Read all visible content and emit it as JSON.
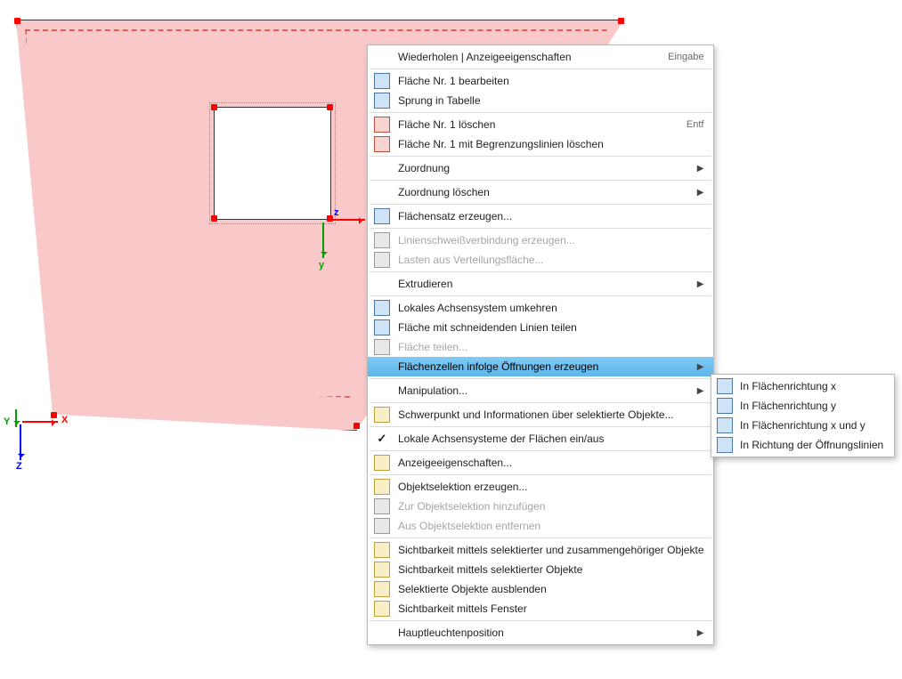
{
  "axes": {
    "x": "x",
    "y": "y",
    "z": "z"
  },
  "axes_global": {
    "x": "X",
    "y": "Y",
    "z": "Z"
  },
  "menu": {
    "repeat_display_props": "Wiederholen | Anzeigeeigenschaften",
    "repeat_shortcut": "Eingabe",
    "edit_surface_1": "Fläche Nr. 1 bearbeiten",
    "jump_to_table": "Sprung in Tabelle",
    "delete_surface_1": "Fläche Nr. 1 löschen",
    "delete_shortcut": "Entf",
    "delete_surface_with_lines": "Fläche Nr. 1 mit Begrenzungslinien löschen",
    "assignment": "Zuordnung",
    "assignment_delete": "Zuordnung löschen",
    "create_surface_set": "Flächensatz erzeugen...",
    "create_weld_line": "Linienschweißverbindung erzeugen...",
    "loads_from_distribution": "Lasten aus Verteilungsfläche...",
    "extrude": "Extrudieren",
    "reverse_local_axis": "Lokales Achsensystem umkehren",
    "split_by_cutting_lines": "Fläche mit schneidenden Linien teilen",
    "split_surface": "Fläche teilen...",
    "cells_from_openings": "Flächenzellen infolge Öffnungen erzeugen",
    "manipulation": "Manipulation...",
    "centroid_info": "Schwerpunkt und Informationen über selektierte Objekte...",
    "local_axes_toggle": "Lokale Achsensysteme der Flächen ein/aus",
    "display_props": "Anzeigeeigenschaften...",
    "create_obj_selection": "Objektselektion erzeugen...",
    "add_to_obj_selection": "Zur Objektselektion hinzufügen",
    "remove_from_obj_selection": "Aus Objektselektion entfernen",
    "visibility_by_sel_related": "Sichtbarkeit mittels selektierter und zusammengehöriger Objekte",
    "visibility_by_selected": "Sichtbarkeit mittels selektierter Objekte",
    "hide_selected": "Selektierte Objekte ausblenden",
    "visibility_by_window": "Sichtbarkeit mittels Fenster",
    "main_light_position": "Hauptleuchtenposition"
  },
  "submenu_cells": {
    "dir_x": "In Flächenrichtung x",
    "dir_y": "In Flächenrichtung y",
    "dir_xy": "In Flächenrichtung x und y",
    "dir_opening_lines": "In Richtung der Öffnungslinien"
  }
}
